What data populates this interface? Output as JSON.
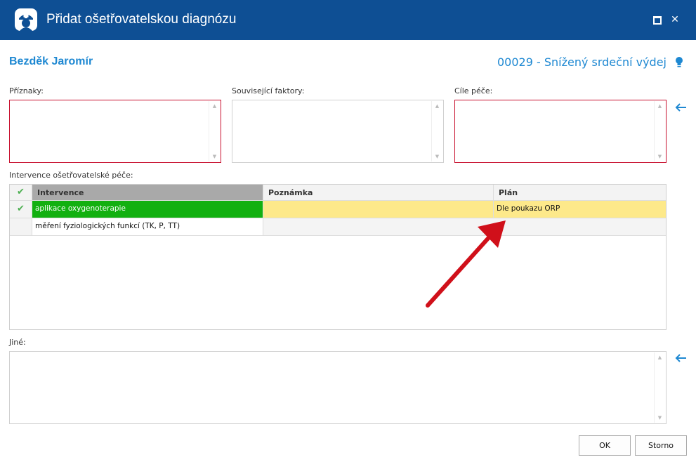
{
  "window": {
    "title": "Přidat ošetřovatelskou diagnózu",
    "icon": "nurse-icon",
    "controls": [
      "maximize-icon",
      "close-icon"
    ]
  },
  "header": {
    "patient_name": "Bezděk Jaromír",
    "diagnosis": "00029 - Snížený srdeční výdej",
    "info_icon": "lightbulb-icon"
  },
  "fields": {
    "symptoms_label": "Příznaky:",
    "related_factors_label": "Související faktory:",
    "care_goals_label": "Cíle péče:",
    "interventions_label": "Intervence ošetřovatelské péče:",
    "other_label": "Jiné:"
  },
  "interventions": {
    "columns": [
      "Intervence",
      "Poznámka",
      "Plán"
    ],
    "rows": [
      {
        "checked": true,
        "intervention": "aplikace oxygenoterapie",
        "note": "",
        "plan": "Dle poukazu ORP"
      },
      {
        "checked": false,
        "intervention": "měření fyziologických funkcí (TK, P, TT)",
        "note": "",
        "plan": ""
      }
    ]
  },
  "buttons": {
    "ok": "OK",
    "cancel": "Storno"
  },
  "colors": {
    "titlebar": "#0e4f94",
    "accent": "#1e88d2",
    "required_border": "#c8102e",
    "selected_green": "#12b010",
    "note_yellow": "#fde98a",
    "annotation_arrow": "#d0101a"
  }
}
